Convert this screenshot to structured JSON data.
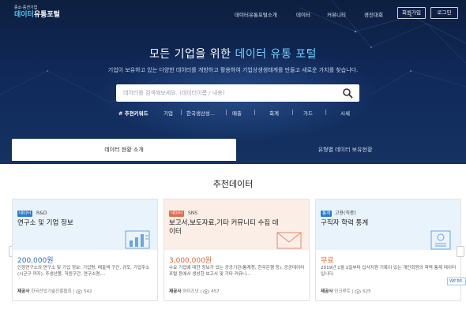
{
  "logo": {
    "sub": "중소·중견기업",
    "main_accent": "데이터",
    "main_white": "유통포털"
  },
  "nav": {
    "items": [
      "데이터유통포털소개",
      "데이터",
      "커뮤니티",
      "경진대회"
    ],
    "signup": "회원가입",
    "login": "로그인"
  },
  "hero": {
    "title_plain": "모든 기업을 위한 ",
    "title_highlight": "데이터 유통 포털",
    "subtitle": "기업이 보유하고 있는 다양한 데이터를 개방하고 활용하여 기업상생생태계를 만들고 새로운 가치를 찾습니다."
  },
  "search": {
    "placeholder": "데이터를 검색해보세요. (데이터이름 / 내용)",
    "icon": "search-icon"
  },
  "keywords": {
    "lead": "# 추천키워드",
    "items": [
      "기업",
      "한국생산성...",
      "매출",
      "회계",
      "가드",
      "시세"
    ]
  },
  "tabs": {
    "active": "데이터 현황 소개",
    "other": "유형별 데이터 보유현황"
  },
  "section": {
    "title": "추천데이터"
  },
  "cards": [
    {
      "badge": "데이터",
      "badge_color": "#2b7ccf",
      "category": "R&D",
      "name": "연구소 및 기업 정보",
      "price": "200,000원",
      "desc": "인정연구소의 연구소 및 기업 정보: 기업명, 매출액 구간, 규모, 기업주소(시군구 까지), 주생산품, 직원구간, 연구소명,...",
      "provider_label": "제공사",
      "provider": "한국산업기술진흥협회",
      "views": "542",
      "icon": "bar-chart-icon"
    },
    {
      "badge": "데이터",
      "badge_color": "#e06a4a",
      "category": "SNS",
      "name": "보고서,보도자료,기타 커뮤니티 수집 데이터",
      "price": "3,000,000원",
      "desc": "수요 기업에 대한 정보가 있는 공공기관(통계청, 한국은행 등), 공공데이터포털 등에서 생성한 보고서 및 기타 커뮤니...",
      "provider_label": "제공사",
      "provider": "와이즈넛",
      "views": "457",
      "icon": "envelope-icon"
    },
    {
      "badge": "통계",
      "badge_color": "#2b7ccf",
      "category": "고용(직종)",
      "name": "구직자 학력 통계",
      "price": "무료",
      "desc": "2019년 1월 1일부터 입사지원 기록이 있는 개인회원의 학력 통계 데이터입니다.",
      "provider_label": "제공사",
      "provider": "인크루트",
      "views": "625",
      "icon": "document-icon"
    }
  ],
  "side_badge": "WE'RE..."
}
